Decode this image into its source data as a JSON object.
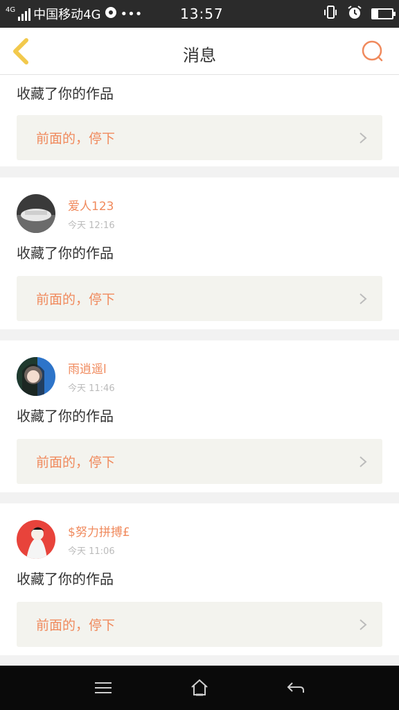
{
  "status_bar": {
    "network_small": "4G",
    "carrier": "中国移动4G",
    "time": "13:57",
    "battery_level": 0.3
  },
  "header": {
    "title": "消息",
    "back_icon": "chevron-left-icon",
    "search_icon": "search-icon"
  },
  "colors": {
    "accent": "#f08a5d",
    "back_arrow": "#f2c94c",
    "card_bg": "#f3f3ee"
  },
  "notifications": [
    {
      "action": "收藏了你的作品",
      "work_title": "前面的，停下"
    },
    {
      "user": "爱人123",
      "time": "今天 12:16",
      "action": "收藏了你的作品",
      "work_title": "前面的，停下"
    },
    {
      "user": "雨逍遥l",
      "time": "今天 11:46",
      "action": "收藏了你的作品",
      "work_title": "前面的，停下"
    },
    {
      "user": "$努力拼搏£",
      "time": "今天 11:06",
      "action": "收藏了你的作品",
      "work_title": "前面的，停下"
    }
  ],
  "nav_bar": {
    "menu_icon": "menu-icon",
    "home_icon": "home-icon",
    "back_icon": "back-arrow-icon"
  }
}
